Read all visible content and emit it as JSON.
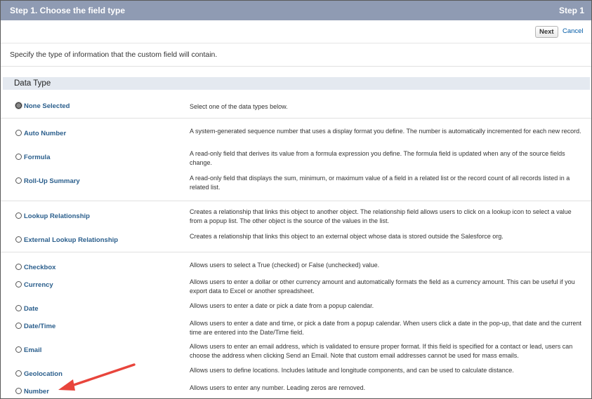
{
  "header": {
    "title": "Step 1. Choose the field type",
    "step": "Step 1"
  },
  "buttons": {
    "next": "Next",
    "cancel": "Cancel"
  },
  "instructions": "Specify the type of information that the custom field will contain.",
  "section_title": "Data Type",
  "options": [
    {
      "label": "None Selected",
      "selected": true,
      "desc": "Select one of the data types below."
    },
    {
      "label": "Auto Number",
      "selected": false,
      "desc": "A system-generated sequence number that uses a display format you define. The number is automatically incremented for each new record."
    },
    {
      "label": "Formula",
      "selected": false,
      "desc": "A read-only field that derives its value from a formula expression you define. The formula field is updated when any of the source fields change."
    },
    {
      "label": "Roll-Up Summary",
      "selected": false,
      "desc": "A read-only field that displays the sum, minimum, or maximum value of a field in a related list or the record count of all records listed in a related list."
    },
    {
      "label": "Lookup Relationship",
      "selected": false,
      "desc": "Creates a relationship that links this object to another object. The relationship field allows users to click on a lookup icon to select a value from a popup list. The other object is the source of the values in the list."
    },
    {
      "label": "External Lookup Relationship",
      "selected": false,
      "desc": "Creates a relationship that links this object to an external object whose data is stored outside the Salesforce org."
    },
    {
      "label": "Checkbox",
      "selected": false,
      "desc": "Allows users to select a True (checked) or False (unchecked) value."
    },
    {
      "label": "Currency",
      "selected": false,
      "desc": "Allows users to enter a dollar or other currency amount and automatically formats the field as a currency amount. This can be useful if you export data to Excel or another spreadsheet."
    },
    {
      "label": "Date",
      "selected": false,
      "desc": "Allows users to enter a date or pick a date from a popup calendar."
    },
    {
      "label": "Date/Time",
      "selected": false,
      "desc": "Allows users to enter a date and time, or pick a date from a popup calendar. When users click a date in the pop-up, that date and the current time are entered into the Date/Time field."
    },
    {
      "label": "Email",
      "selected": false,
      "desc": "Allows users to enter an email address, which is validated to ensure proper format. If this field is specified for a contact or lead, users can choose the address when clicking Send an Email. Note that custom email addresses cannot be used for mass emails."
    },
    {
      "label": "Geolocation",
      "selected": false,
      "desc": "Allows users to define locations. Includes latitude and longitude components, and can be used to calculate distance."
    },
    {
      "label": "Number",
      "selected": false,
      "desc": "Allows users to enter any number. Leading zeros are removed."
    }
  ],
  "colors": {
    "header_bg": "#8f9bb3",
    "section_bg": "#e4e9f0",
    "link": "#2a5e8c",
    "arrow": "#e8453c"
  }
}
